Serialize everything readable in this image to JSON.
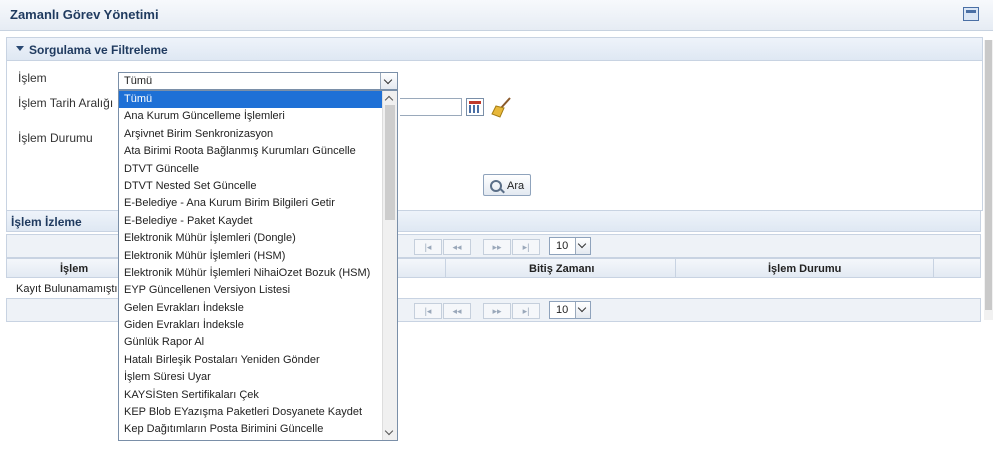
{
  "window": {
    "title": "Zamanlı Görev Yönetimi"
  },
  "filter_panel": {
    "title": "Sorgulama ve Filtreleme",
    "labels": {
      "islem": "İşlem",
      "tarih": "İşlem Tarih Aralığı",
      "durum": "İşlem Durumu"
    },
    "islem_selected": "Tümü",
    "search_button": "Ara"
  },
  "dropdown": {
    "options": [
      "Tümü",
      "Ana Kurum Güncelleme İşlemleri",
      "Arşivnet Birim Senkronizasyon",
      "Ata Birimi Roota Bağlanmış Kurumları Güncelle",
      "DTVT Güncelle",
      "DTVT Nested Set Güncelle",
      "E-Belediye - Ana Kurum Birim Bilgileri Getir",
      "E-Belediye - Paket Kaydet",
      "Elektronik Mühür İşlemleri (Dongle)",
      "Elektronik Mühür İşlemleri (HSM)",
      "Elektronik Mühür İşlemleri NihaiOzet Bozuk (HSM)",
      "EYP Güncellenen Versiyon Listesi",
      "Gelen Evrakları İndeksle",
      "Giden Evrakları İndeksle",
      "Günlük Rapor Al",
      "Hatalı Birleşik Postaları Yeniden Gönder",
      "İşlem Süresi Uyar",
      "KAYSİSten Sertifikaları Çek",
      "KEP Blob EYazışma Paketleri Dosyanete Kaydet",
      "Kep Dağıtımların Posta Birimini Güncelle"
    ]
  },
  "monitor": {
    "title": "İşlem İzleme",
    "page_size": "10",
    "columns": [
      "İşlem",
      "Bitiş Zamanı",
      "İşlem Durumu"
    ],
    "empty_text": "Kayıt Bulunamamıştır"
  },
  "pager_buttons": [
    "|◂",
    "◂◂",
    "▸▸",
    "▸|"
  ]
}
